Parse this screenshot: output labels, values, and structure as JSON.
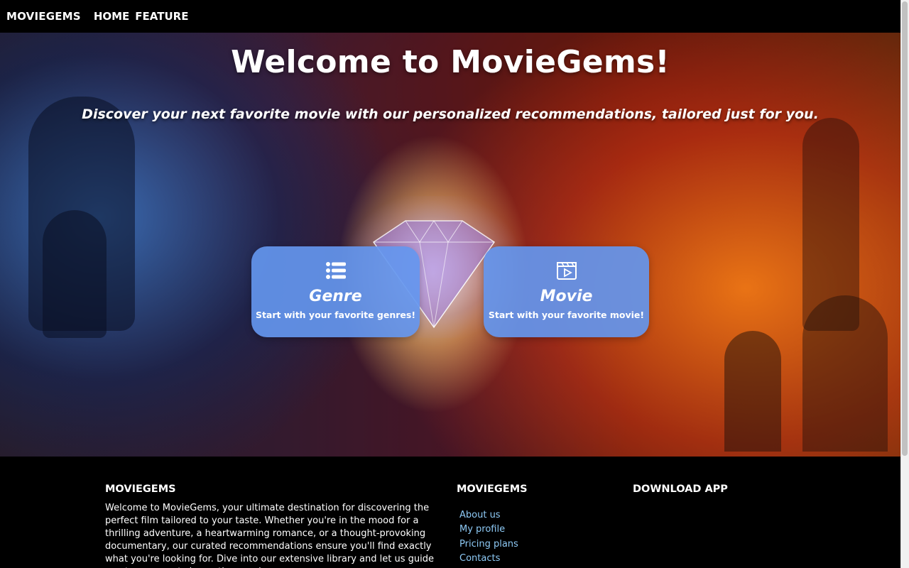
{
  "nav": {
    "brand": "MOVIEGEMS",
    "links": [
      "HOME",
      "FEATURE"
    ]
  },
  "hero": {
    "title": "Welcome to MovieGems!",
    "subtitle": "Discover your next favorite movie with our personalized recommendations, tailored just for you."
  },
  "cards": [
    {
      "title": "Genre",
      "subtitle": "Start with your favorite genres!",
      "icon": "list-icon"
    },
    {
      "title": "Movie",
      "subtitle": "Start with your favorite movie!",
      "icon": "clapperboard-icon"
    }
  ],
  "footer": {
    "about_heading": "MOVIEGEMS",
    "about_text": "Welcome to MovieGems, your ultimate destination for discovering the perfect film tailored to your taste. Whether you're in the mood for a thrilling adventure, a heartwarming romance, or a thought-provoking documentary, our curated recommendations ensure you'll find exactly what you're looking for. Dive into our extensive library and let us guide you to your next cinematic experience.",
    "links_heading": "MOVIEGEMS",
    "links": [
      "About us",
      "My profile",
      "Pricing plans",
      "Contacts"
    ],
    "download_heading": "DOWNLOAD APP"
  },
  "colors": {
    "card_bg": "#6496ee",
    "link": "#8ecaf6",
    "nav_bg": "#000000"
  }
}
